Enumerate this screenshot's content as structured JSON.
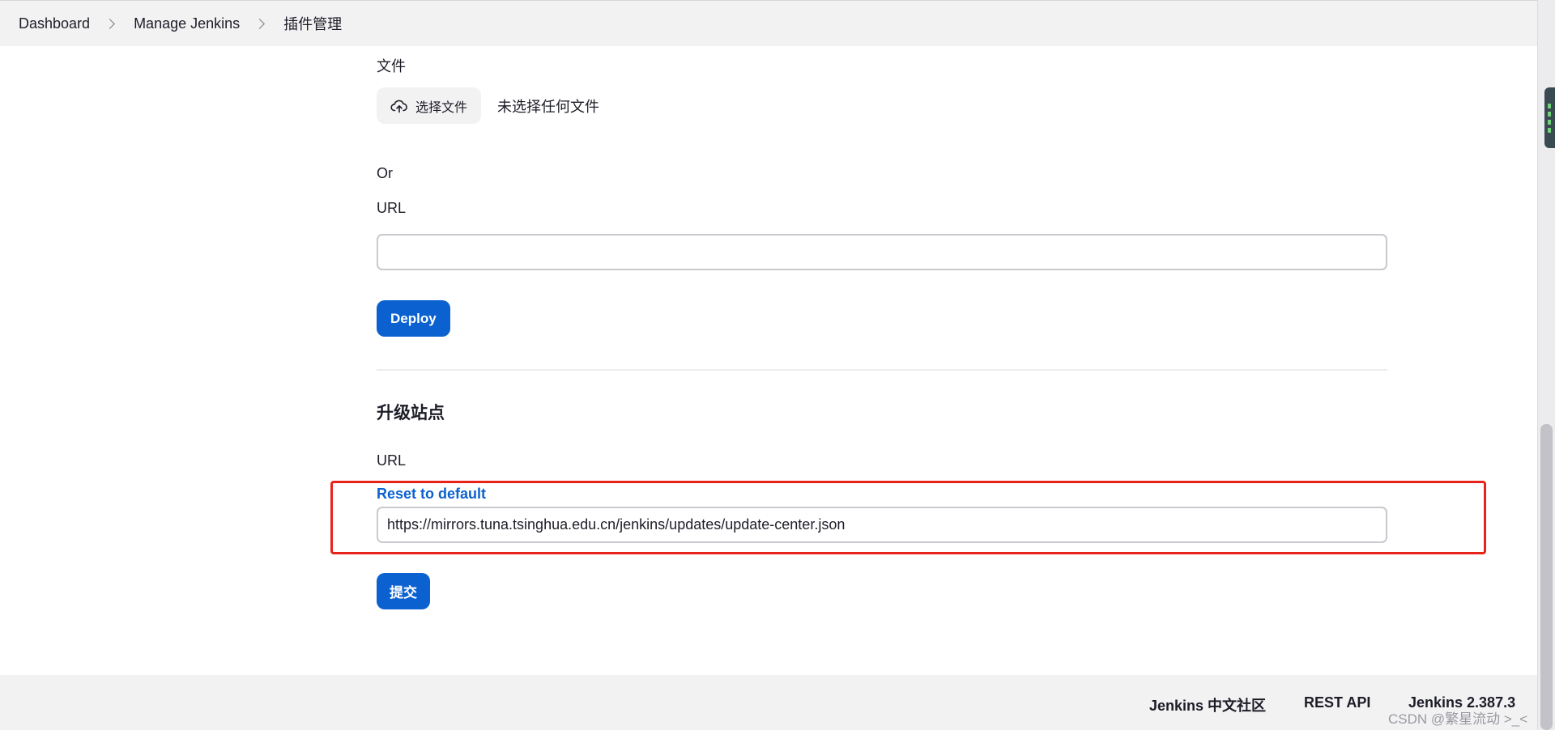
{
  "breadcrumb": {
    "items": [
      "Dashboard",
      "Manage Jenkins",
      "插件管理"
    ]
  },
  "upload": {
    "file_label": "文件",
    "choose_button_label": "选择文件",
    "file_status": "未选择任何文件",
    "or_label": "Or",
    "url_label": "URL",
    "url_value": "",
    "deploy_label": "Deploy"
  },
  "update_site": {
    "title": "升级站点",
    "url_label": "URL",
    "reset_link": "Reset to default",
    "url_value": "https://mirrors.tuna.tsinghua.edu.cn/jenkins/updates/update-center.json",
    "submit_label": "提交"
  },
  "footer": {
    "community_link": "Jenkins 中文社区",
    "rest_api_link": "REST API",
    "version": "Jenkins 2.387.3"
  },
  "watermark": "CSDN @繁星流动 >_<",
  "colors": {
    "primary": "#0b61d0",
    "highlight": "#e8241a",
    "bar_background": "#f2f2f3"
  },
  "icons": {
    "upload": "cloud-upload-icon",
    "separator": "chevron-right-icon"
  }
}
